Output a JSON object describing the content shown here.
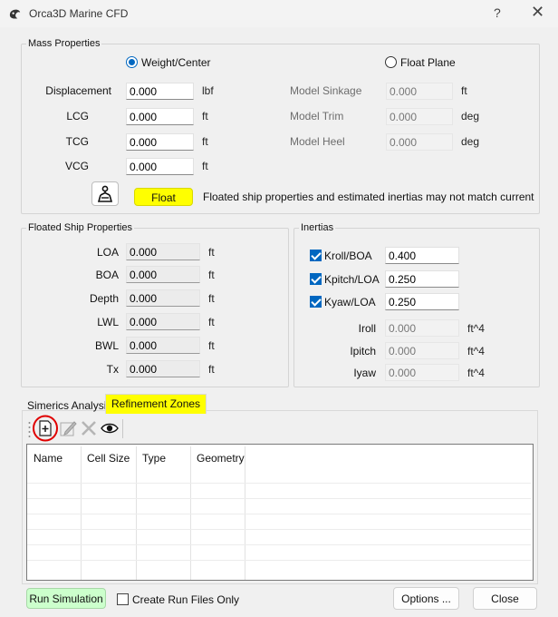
{
  "window": {
    "title": "Orca3D Marine CFD",
    "help": "?",
    "close": "✕"
  },
  "mass": {
    "legend": "Mass Properties",
    "radio_weight": "Weight/Center",
    "radio_float": "Float Plane",
    "rows": [
      {
        "label": "Displacement",
        "value": "0.000",
        "unit": "lbf"
      },
      {
        "label": "LCG",
        "value": "0.000",
        "unit": "ft"
      },
      {
        "label": "TCG",
        "value": "0.000",
        "unit": "ft"
      },
      {
        "label": "VCG",
        "value": "0.000",
        "unit": "ft"
      }
    ],
    "model_rows": [
      {
        "label": "Model Sinkage",
        "value": "0.000",
        "unit": "ft"
      },
      {
        "label": "Model Trim",
        "value": "0.000",
        "unit": "deg"
      },
      {
        "label": "Model Heel",
        "value": "0.000",
        "unit": "deg"
      }
    ],
    "float_button": "Float",
    "float_message": "Floated ship properties and estimated inertias may not match current in..."
  },
  "floated": {
    "legend": "Floated Ship Properties",
    "rows": [
      {
        "label": "LOA",
        "value": "0.000",
        "unit": "ft"
      },
      {
        "label": "BOA",
        "value": "0.000",
        "unit": "ft"
      },
      {
        "label": "Depth",
        "value": "0.000",
        "unit": "ft"
      },
      {
        "label": "LWL",
        "value": "0.000",
        "unit": "ft"
      },
      {
        "label": "BWL",
        "value": "0.000",
        "unit": "ft"
      },
      {
        "label": "Tx",
        "value": "0.000",
        "unit": "ft"
      }
    ]
  },
  "inertias": {
    "legend": "Inertias",
    "checks": [
      {
        "label": "Kroll/BOA",
        "value": "0.400"
      },
      {
        "label": "Kpitch/LOA",
        "value": "0.250"
      },
      {
        "label": "Kyaw/LOA",
        "value": "0.250"
      }
    ],
    "rows": [
      {
        "label": "Iroll",
        "value": "0.000",
        "unit": "ft^4"
      },
      {
        "label": "Ipitch",
        "value": "0.000",
        "unit": "ft^4"
      },
      {
        "label": "Iyaw",
        "value": "0.000",
        "unit": "ft^4"
      }
    ]
  },
  "tabs": {
    "simerics": "Simerics Analysis",
    "refinement": "Refinement Zones"
  },
  "grid": {
    "headers": [
      "Name",
      "Cell Size",
      "Type",
      "Geometry"
    ]
  },
  "footer": {
    "run": "Run Simulation",
    "create_files": "Create Run Files Only",
    "options": "Options ...",
    "close": "Close"
  },
  "colors": {
    "accent": "#0067c0",
    "highlight": "#ffff00",
    "run_button": "#ccffcc",
    "annotation": "#e00000"
  }
}
